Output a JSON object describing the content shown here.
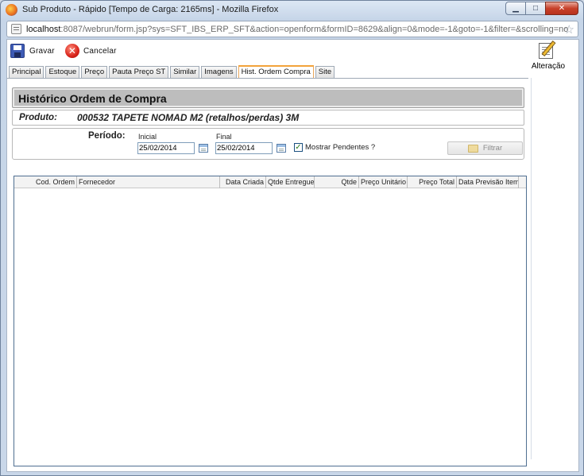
{
  "window": {
    "title": "Sub Produto - Rápido [Tempo de Carga: 2165ms] - Mozilla Firefox",
    "minimize_glyph": "▁",
    "maximize_glyph": "□",
    "close_glyph": "✕"
  },
  "urlbar": {
    "host": "localhost",
    "path": ":8087/webrun/form.jsp?sys=SFT_IBS_ERP_SFT&action=openform&formID=8629&align=0&mode=-1&goto=-1&filter=&scrolling=no",
    "star_glyph": "☆"
  },
  "toolbar": {
    "save_label": "Gravar",
    "cancel_label": "Cancelar",
    "cancel_glyph": "✕",
    "alteracao_label": "Alteração"
  },
  "tabs": [
    {
      "label": "Principal",
      "active": false
    },
    {
      "label": "Estoque",
      "active": false
    },
    {
      "label": "Preço",
      "active": false
    },
    {
      "label": "Pauta Preço ST",
      "active": false
    },
    {
      "label": "Similar",
      "active": false
    },
    {
      "label": "Imagens",
      "active": false
    },
    {
      "label": "Hist. Ordem Compra",
      "active": true
    },
    {
      "label": "Site",
      "active": false
    }
  ],
  "page": {
    "title": "Histórico Ordem de Compra",
    "produto_label": "Produto:",
    "produto_value": "000532 TAPETE NOMAD M2 (retalhos/perdas) 3M"
  },
  "filters": {
    "periodo_label": "Período:",
    "inicial_label": "Inicial",
    "inicial_value": "25/02/2014",
    "final_label": "Final",
    "final_value": "25/02/2014",
    "pendentes_label": "Mostrar Pendentes ?",
    "pendentes_checked": true,
    "check_glyph": "✓",
    "filtrar_label": "Filtrar"
  },
  "grid": {
    "columns": [
      "Cod. Ordem",
      "Fornecedor",
      "Data Criada",
      "Qtde Entregue",
      "Qtde",
      "Preço Unitário",
      "Preço Total",
      "Data Previsão Item"
    ],
    "rows": []
  },
  "icons": {
    "firefox": "firefox-icon",
    "page": "page-icon",
    "star": "star-icon",
    "save": "save-icon",
    "cancel": "cancel-icon",
    "edit": "pencil-icon",
    "calendar": "calendar-icon",
    "folder": "folder-icon"
  }
}
